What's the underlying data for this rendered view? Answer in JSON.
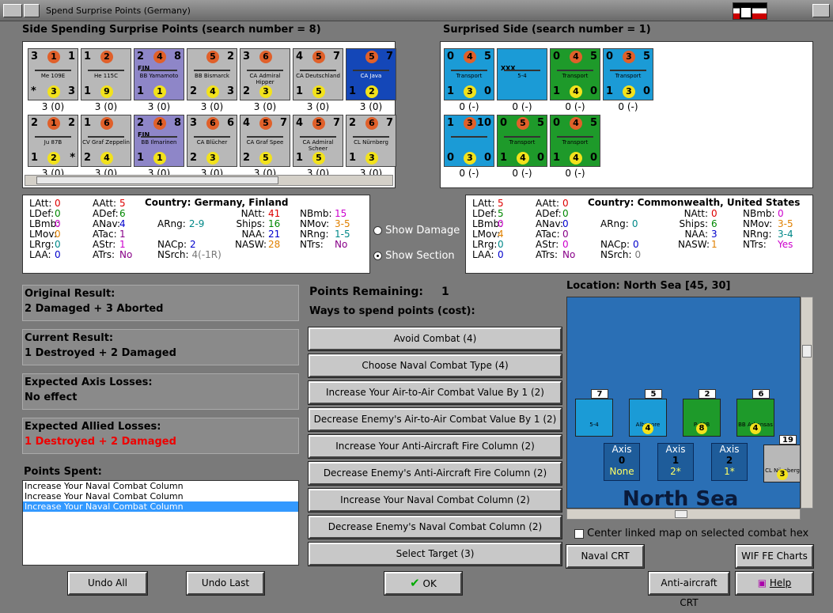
{
  "window": {
    "title": "Spend Surprise Points (Germany)"
  },
  "left_header": "Side Spending Surprise Points (search number = 8)",
  "right_header": "Surprised Side (search number = 1)",
  "left_units": [
    {
      "name": "Me 109E",
      "tl": "3",
      "tr": "1",
      "bl": "*",
      "br": "3",
      "mid": "1",
      "bot": "3",
      "cap": "3 (0)",
      "color": "#b8b8b8"
    },
    {
      "name": "He 115C",
      "tl": "1",
      "tr": "",
      "bl": "1",
      "br": "",
      "mid": "2",
      "bot": "9",
      "cap": "3 (0)",
      "color": "#b8b8b8"
    },
    {
      "name": "BB Yamamoto",
      "tl": "2",
      "tr": "8",
      "bl": "1",
      "br": "",
      "mid": "4",
      "bot": "1",
      "cap": "3 (0)",
      "color": "#8e86c8",
      "extra": "FIN"
    },
    {
      "name": "BB Bismarck",
      "tl": "",
      "tr": "2",
      "bl": "2",
      "br": "3",
      "mid": "5",
      "bot": "4",
      "cap": "3 (0)",
      "color": "#b8b8b8"
    },
    {
      "name": "CA Admiral Hipper",
      "tl": "3",
      "tr": "",
      "bl": "2",
      "br": "",
      "mid": "6",
      "bot": "3",
      "cap": "3 (0)",
      "color": "#b8b8b8"
    },
    {
      "name": "CA Deutschland",
      "tl": "4",
      "tr": "7",
      "bl": "1",
      "br": "",
      "mid": "5",
      "bot": "5",
      "cap": "3 (0)",
      "color": "#b8b8b8"
    },
    {
      "name": "CA Java",
      "tl": "",
      "tr": "7",
      "bl": "1",
      "br": "",
      "mid": "5",
      "bot": "2",
      "cap": "3 (0)",
      "color": "#1447b8"
    },
    {
      "name": "Ju 87B",
      "tl": "2",
      "tr": "2",
      "bl": "1",
      "br": "*",
      "mid": "1",
      "bot": "2",
      "cap": "3 (0)",
      "color": "#b8b8b8"
    },
    {
      "name": "CV Graf Zeppelin",
      "tl": "1",
      "tr": "",
      "bl": "2",
      "br": "",
      "mid": "6",
      "bot": "4",
      "cap": "3 (0)",
      "color": "#b8b8b8"
    },
    {
      "name": "BB Ilmarinen",
      "tl": "2",
      "tr": "8",
      "bl": "1",
      "br": "",
      "mid": "4",
      "bot": "1",
      "cap": "3 (0)",
      "color": "#8e86c8",
      "extra": "FIN"
    },
    {
      "name": "CA Blücher",
      "tl": "3",
      "tr": "6",
      "bl": "2",
      "br": "",
      "mid": "6",
      "bot": "3",
      "cap": "3 (0)",
      "color": "#b8b8b8"
    },
    {
      "name": "CA Graf Spee",
      "tl": "4",
      "tr": "7",
      "bl": "2",
      "br": "",
      "mid": "5",
      "bot": "5",
      "cap": "3 (0)",
      "color": "#b8b8b8"
    },
    {
      "name": "CA Admiral Scheer",
      "tl": "4",
      "tr": "7",
      "bl": "1",
      "br": "",
      "mid": "5",
      "bot": "5",
      "cap": "3 (0)",
      "color": "#b8b8b8"
    },
    {
      "name": "CL Nürnberg",
      "tl": "2",
      "tr": "7",
      "bl": "1",
      "br": "",
      "mid": "6",
      "bot": "3",
      "cap": "3 (0)",
      "color": "#b8b8b8"
    }
  ],
  "right_units": [
    {
      "name": "Transport",
      "tl": "0",
      "tr": "5",
      "bl": "1",
      "br": "0",
      "mid": "4",
      "bot": "3",
      "cap": "0 (-)",
      "color": "#1b9bd6"
    },
    {
      "name": "5-4",
      "tl": "",
      "tr": "",
      "bl": "",
      "br": "",
      "mid": "",
      "bot": "",
      "cap": "0 (-)",
      "color": "#1b9bd6",
      "extra": "XXX"
    },
    {
      "name": "Transport",
      "tl": "0",
      "tr": "5",
      "bl": "1",
      "br": "0",
      "mid": "4",
      "bot": "4",
      "cap": "0 (-)",
      "color": "#1e9a2a"
    },
    {
      "name": "Transport",
      "tl": "0",
      "tr": "5",
      "bl": "1",
      "br": "0",
      "mid": "3",
      "bot": "3",
      "cap": "0 (-)",
      "color": "#1b9bd6"
    },
    {
      "name": "",
      "tl": "1",
      "tr": "10",
      "bl": "0",
      "br": "0",
      "mid": "3",
      "bot": "3",
      "cap": "0 (-)",
      "color": "#1b9bd6"
    },
    {
      "name": "Transport",
      "tl": "0",
      "tr": "5",
      "bl": "1",
      "br": "0",
      "mid": "5",
      "bot": "4",
      "cap": "0 (-)",
      "color": "#1e9a2a"
    },
    {
      "name": "Transport",
      "tl": "0",
      "tr": "5",
      "bl": "1",
      "br": "0",
      "mid": "4",
      "bot": "4",
      "cap": "0 (-)",
      "color": "#1e9a2a"
    }
  ],
  "left_info": {
    "country": "Country: Germany, Finland",
    "rows": [
      {
        "l": "LAtt:",
        "v": "0",
        "c": "red",
        "l2": "AAtt:",
        "v2": "5",
        "c2": "red"
      },
      {
        "l": "LDef:",
        "v": "0",
        "c": "grn",
        "l2": "ADef:",
        "v2": "6",
        "c2": "grn"
      },
      {
        "l": "LBmb:",
        "v": "0",
        "c": "mag",
        "l2": "ANav:",
        "v2": "4",
        "c2": "blu"
      },
      {
        "l": "LMov:",
        "v": "0",
        "c": "org",
        "l2": "ATac:",
        "v2": "1",
        "c2": "pur"
      },
      {
        "l": "LRrg:",
        "v": "0",
        "c": "teal",
        "l2": "AStr:",
        "v2": "1",
        "c2": "mag"
      },
      {
        "l": "LAA:",
        "v": "0",
        "c": "blu",
        "l2": "ATrs:",
        "v2": "No",
        "c2": "pur"
      }
    ],
    "mid": [
      {
        "l": "",
        "v": "",
        "c": ""
      },
      {
        "l": "NAtt:",
        "v": "41",
        "c": "red"
      },
      {
        "l": "Ships:",
        "v": "16",
        "c": "grn"
      },
      {
        "l": "NAA:",
        "v": "21",
        "c": "blu"
      },
      {
        "l": "NASW:",
        "v": "28",
        "c": "org"
      }
    ],
    "arng": {
      "l": "ARng:",
      "v": "2-9",
      "c": "teal"
    },
    "nacp": {
      "l": "NACp:",
      "v": "2",
      "c": "blu"
    },
    "nsrch": {
      "l": "NSrch:",
      "v": "4(-1R)",
      "c": "gry"
    },
    "right": [
      {
        "l": "NBmb:",
        "v": "15",
        "c": "mag"
      },
      {
        "l": "NMov:",
        "v": "3-5",
        "c": "org"
      },
      {
        "l": "NRng:",
        "v": "1-5",
        "c": "teal"
      },
      {
        "l": "NTrs:",
        "v": "No",
        "c": "pur"
      }
    ]
  },
  "right_info": {
    "country": "Country: Commonwealth, United States",
    "rows": [
      {
        "l": "LAtt:",
        "v": "5",
        "c": "red",
        "l2": "AAtt:",
        "v2": "0",
        "c2": "red"
      },
      {
        "l": "LDef:",
        "v": "5",
        "c": "grn",
        "l2": "ADef:",
        "v2": "0",
        "c2": "grn"
      },
      {
        "l": "LBmb:",
        "v": "0",
        "c": "mag",
        "l2": "ANav:",
        "v2": "0",
        "c2": "blu"
      },
      {
        "l": "LMov:",
        "v": "4",
        "c": "org",
        "l2": "ATac:",
        "v2": "0",
        "c2": "pur"
      },
      {
        "l": "LRrg:",
        "v": "0",
        "c": "teal",
        "l2": "AStr:",
        "v2": "0",
        "c2": "mag"
      },
      {
        "l": "LAA:",
        "v": "0",
        "c": "blu",
        "l2": "ATrs:",
        "v2": "No",
        "c2": "pur"
      }
    ],
    "mid": [
      {
        "l": "",
        "v": "",
        "c": ""
      },
      {
        "l": "NAtt:",
        "v": "0",
        "c": "red"
      },
      {
        "l": "Ships:",
        "v": "6",
        "c": "grn"
      },
      {
        "l": "NAA:",
        "v": "3",
        "c": "blu"
      },
      {
        "l": "NASW:",
        "v": "1",
        "c": "org"
      }
    ],
    "arng": {
      "l": "ARng:",
      "v": "0",
      "c": "teal"
    },
    "nacp": {
      "l": "NACp:",
      "v": "0",
      "c": "blu"
    },
    "nsrch": {
      "l": "NSrch:",
      "v": "0",
      "c": "gry"
    },
    "right": [
      {
        "l": "NBmb:",
        "v": "0",
        "c": "mag"
      },
      {
        "l": "NMov:",
        "v": "3-5",
        "c": "org"
      },
      {
        "l": "NRng:",
        "v": "3-4",
        "c": "teal"
      },
      {
        "l": "NTrs:",
        "v": "Yes",
        "c": "mag"
      }
    ]
  },
  "radio": {
    "show_damage": "Show Damage",
    "show_section": "Show Section"
  },
  "results": {
    "original_label": "Original Result:",
    "original_value": "2 Damaged + 3 Aborted",
    "current_label": "Current Result:",
    "current_value": "1 Destroyed + 2 Damaged",
    "axis_label": "Expected Axis Losses:",
    "axis_value": "No effect",
    "allied_label": "Expected Allied Losses:",
    "allied_value": "1 Destroyed + 2 Damaged",
    "spent_label": "Points Spent:"
  },
  "points_spent": [
    "Increase Your Naval Combat Column",
    "Increase Your Naval Combat Column",
    "Increase Your Naval Combat Column"
  ],
  "points_remaining_label": "Points Remaining:",
  "points_remaining": "1",
  "ways_label": "Ways to spend points (cost):",
  "ways": [
    "Avoid Combat (4)",
    "Choose Naval Combat Type (4)",
    "Increase Your Air-to-Air Combat Value By 1 (2)",
    "Decrease Enemy's Air-to-Air Combat Value By 1 (2)",
    "Increase Your Anti-Aircraft Fire Column (2)",
    "Decrease Enemy's Anti-Aircraft Fire Column (2)",
    "Increase Your Naval Combat Column (2)",
    "Decrease Enemy's Naval Combat Column (2)",
    "Select Target (3)"
  ],
  "location": "Location: North Sea [45, 30]",
  "map": {
    "sea_name": "North Sea",
    "axis_boxes": [
      {
        "label": "Axis",
        "num": "0",
        "sub": "None"
      },
      {
        "label": "Axis",
        "num": "1",
        "sub": "2*"
      },
      {
        "label": "Axis",
        "num": "2",
        "sub": "1*"
      }
    ],
    "stack_counts": [
      "7",
      "5",
      "2",
      "6",
      "19"
    ],
    "map_units": [
      {
        "name": "5-4",
        "extra": "XXX"
      },
      {
        "name": "Albacore",
        "num": "4"
      },
      {
        "name": "P-40B",
        "num": "8"
      },
      {
        "name": "BB Arkansas",
        "num": "4"
      },
      {
        "name": "CL Nürnberg",
        "num": "3"
      }
    ]
  },
  "center_link": "Center linked map on selected combat hex",
  "buttons": {
    "undo_all": "Undo All",
    "undo_last": "Undo Last",
    "ok": "OK",
    "naval_crt": "Naval CRT",
    "wif_charts": "WIF FE Charts",
    "aa_crt": "Anti-aircraft CRT",
    "help": "Help"
  }
}
